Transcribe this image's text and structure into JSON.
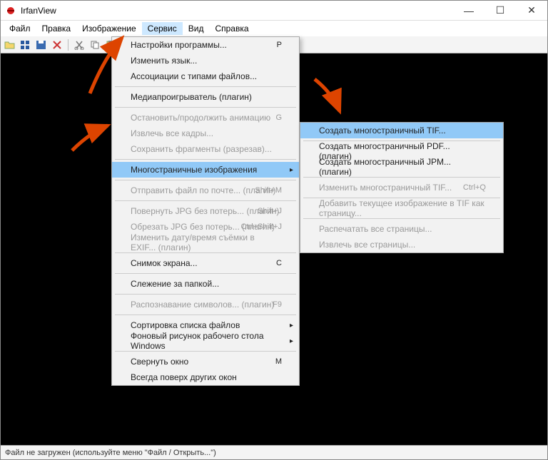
{
  "window": {
    "title": "IrfanView"
  },
  "menubar": {
    "items": [
      "Файл",
      "Правка",
      "Изображение",
      "Сервис",
      "Вид",
      "Справка"
    ],
    "open_index": 3
  },
  "dropdown": {
    "groups": [
      [
        {
          "label": "Настройки программы...",
          "shortcut": "P",
          "enabled": true
        },
        {
          "label": "Изменить язык...",
          "enabled": true
        },
        {
          "label": "Ассоциации с типами файлов...",
          "enabled": true
        }
      ],
      [
        {
          "label": "Медиапроигрыватель (плагин)",
          "enabled": true
        }
      ],
      [
        {
          "label": "Остановить/продолжить анимацию",
          "shortcut": "G",
          "enabled": false
        },
        {
          "label": "Извлечь все кадры...",
          "enabled": false
        },
        {
          "label": "Сохранить фрагменты (разрезав)...",
          "enabled": false
        }
      ],
      [
        {
          "label": "Многостраничные изображения",
          "enabled": true,
          "highlight": true,
          "submenu": true
        }
      ],
      [
        {
          "label": "Отправить файл по почте... (плагин)",
          "shortcut": "Shift+M",
          "enabled": false
        }
      ],
      [
        {
          "label": "Повернуть JPG без потерь... (плагин)",
          "shortcut": "Shift+J",
          "enabled": false
        },
        {
          "label": "Обрезать JPG без потерь... (плагин)",
          "shortcut": "Ctrl+Shift+J",
          "enabled": false
        },
        {
          "label": "Изменить дату/время съёмки в EXIF... (плагин)",
          "enabled": false
        }
      ],
      [
        {
          "label": "Снимок экрана...",
          "shortcut": "C",
          "enabled": true
        }
      ],
      [
        {
          "label": "Слежение за папкой...",
          "enabled": true
        }
      ],
      [
        {
          "label": "Распознавание символов... (плагин)",
          "shortcut": "F9",
          "enabled": false
        }
      ],
      [
        {
          "label": "Сортировка списка файлов",
          "enabled": true,
          "submenu": true
        },
        {
          "label": "Фоновый рисунок рабочего стола Windows",
          "enabled": true,
          "submenu": true
        }
      ],
      [
        {
          "label": "Свернуть окно",
          "shortcut": "M",
          "enabled": true
        },
        {
          "label": "Всегда поверх других окон",
          "enabled": true
        }
      ]
    ]
  },
  "submenu": {
    "groups": [
      [
        {
          "label": "Создать многостраничный TIF...",
          "enabled": true,
          "highlight": true
        }
      ],
      [
        {
          "label": "Создать многостраничный PDF... (плагин)",
          "enabled": true
        },
        {
          "label": "Создать многостраничный JPM... (плагин)",
          "enabled": true
        }
      ],
      [
        {
          "label": "Изменить многостраничный TIF...",
          "shortcut": "Ctrl+Q",
          "enabled": false
        }
      ],
      [
        {
          "label": "Добавить текущее изображение в TIF как страницу...",
          "enabled": false
        }
      ],
      [
        {
          "label": "Распечатать все страницы...",
          "enabled": false
        },
        {
          "label": "Извлечь все страницы...",
          "enabled": false
        }
      ]
    ]
  },
  "status": {
    "text": "Файл не загружен (используйте меню \"Файл / Открыть...\")"
  }
}
